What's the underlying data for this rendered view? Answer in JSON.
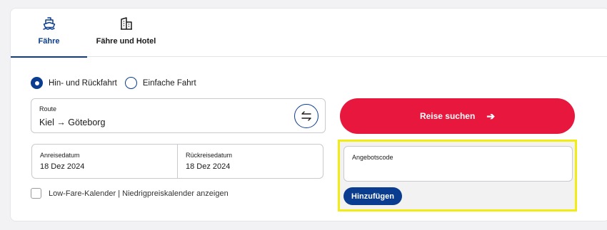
{
  "tabs": [
    {
      "label": "Fähre",
      "icon": "ferry-icon",
      "active": true
    },
    {
      "label": "Fähre und Hotel",
      "icon": "hotel-building-icon",
      "active": false
    }
  ],
  "trip_type": {
    "options": [
      {
        "label": "Hin- und Rückfahrt",
        "selected": true
      },
      {
        "label": "Einfache Fahrt",
        "selected": false
      }
    ]
  },
  "route": {
    "label": "Route",
    "value": "Kiel → Göteborg",
    "swap_icon": "swap-arrows-icon"
  },
  "dates": {
    "depart": {
      "label": "Anreisedatum",
      "value": "18 Dez 2024"
    },
    "return": {
      "label": "Rückreisedatum",
      "value": "18 Dez 2024"
    }
  },
  "calendar_toggle": {
    "label": "Low-Fare-Kalender | Niedrigpreiskalender anzeigen",
    "checked": false
  },
  "search": {
    "label": "Reise suchen",
    "icon": "arrow-right-icon"
  },
  "promo": {
    "label": "Angebotscode",
    "value": "",
    "add_label": "Hinzufügen"
  },
  "colors": {
    "brand_blue": "#0a3d8f",
    "search_red": "#e8173d",
    "highlight_yellow": "#f2ec14"
  }
}
